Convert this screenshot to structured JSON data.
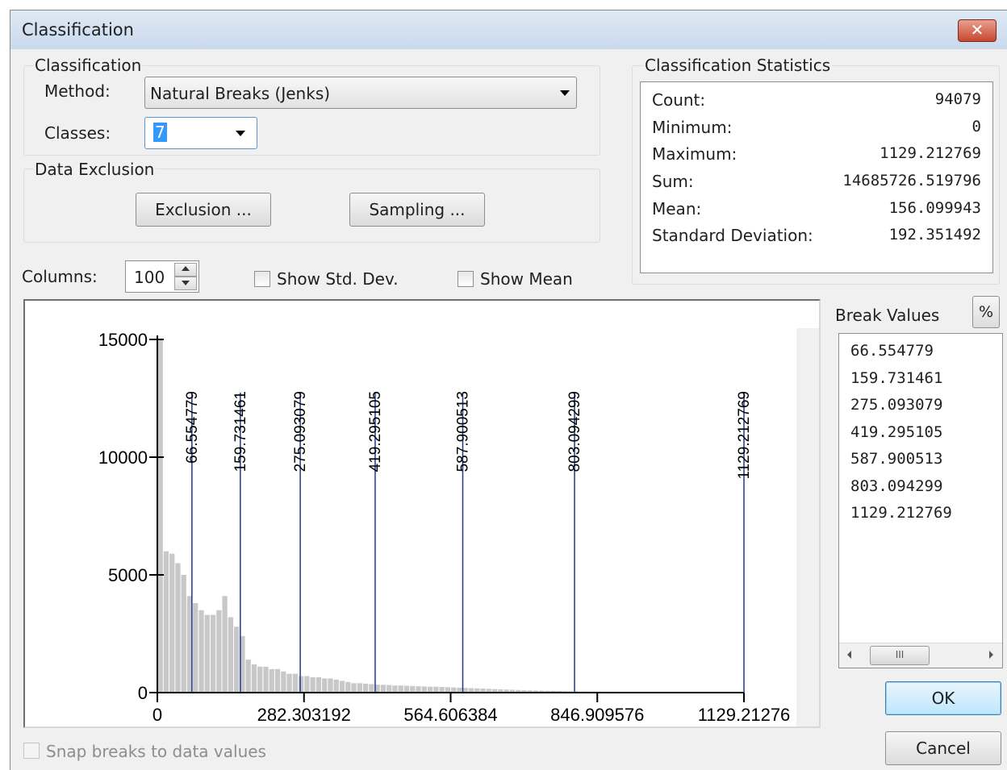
{
  "window": {
    "title": "Classification",
    "close_glyph": "✕"
  },
  "classification": {
    "group_label": "Classification",
    "method_label": "Method:",
    "method_value": "Natural Breaks (Jenks)",
    "classes_label": "Classes:",
    "classes_value": "7"
  },
  "data_exclusion": {
    "group_label": "Data Exclusion",
    "exclusion_button": "Exclusion ...",
    "sampling_button": "Sampling ..."
  },
  "statistics": {
    "group_label": "Classification Statistics",
    "rows": [
      {
        "label": "Count:",
        "value": "94079"
      },
      {
        "label": "Minimum:",
        "value": "0"
      },
      {
        "label": "Maximum:",
        "value": "1129.212769"
      },
      {
        "label": "Sum:",
        "value": "14685726.519796"
      },
      {
        "label": "Mean:",
        "value": "156.099943"
      },
      {
        "label": "Standard Deviation:",
        "value": "192.351492"
      }
    ]
  },
  "columns": {
    "label": "Columns:",
    "value": "100"
  },
  "show_std_dev": {
    "label": "Show Std. Dev.",
    "checked": false
  },
  "show_mean": {
    "label": "Show Mean",
    "checked": false
  },
  "break_values": {
    "label": "Break Values",
    "percent_button": "%",
    "values": [
      "66.554779",
      "159.731461",
      "275.093079",
      "419.295105",
      "587.900513",
      "803.094299",
      "1129.212769"
    ],
    "scroll_thumb": "III"
  },
  "snap_breaks": {
    "label": "Snap breaks to data values",
    "enabled": false
  },
  "buttons": {
    "ok": "OK",
    "cancel": "Cancel"
  },
  "colors": {
    "bar": "#c8c8c8",
    "break_line": "#1f3a8a",
    "title_bar": "#d2e0f0",
    "close_button": "#c8472e"
  },
  "chart_data": {
    "type": "bar",
    "title": "",
    "xlabel": "",
    "ylabel": "",
    "xlim": [
      0,
      1129.212769
    ],
    "ylim": [
      0,
      15000
    ],
    "y_ticks": [
      "0",
      "5000",
      "10000",
      "15000"
    ],
    "x_ticks": [
      "0",
      "282.303192",
      "564.606384",
      "846.909576",
      "1129.21276"
    ],
    "bin_width": 11.29212769,
    "counts": [
      15000,
      6000,
      5900,
      5500,
      5000,
      4100,
      3800,
      3500,
      3300,
      3300,
      3500,
      4100,
      3200,
      2800,
      2400,
      1400,
      1200,
      1100,
      1100,
      1000,
      1000,
      900,
      800,
      800,
      700,
      700,
      650,
      650,
      600,
      600,
      550,
      500,
      450,
      400,
      400,
      380,
      360,
      340,
      330,
      320,
      300,
      300,
      290,
      280,
      270,
      260,
      250,
      250,
      240,
      230,
      220,
      210,
      200,
      190,
      180,
      170,
      160,
      150,
      140,
      130,
      120,
      110,
      100,
      95,
      90,
      85,
      80,
      75,
      70,
      60,
      50,
      48,
      46,
      44,
      42,
      40,
      38,
      36,
      34,
      32,
      30,
      28,
      26,
      24,
      22,
      20,
      18,
      16,
      14,
      12,
      10,
      9,
      8,
      7,
      6,
      5,
      4,
      3,
      2,
      1
    ],
    "break_values": [
      66.554779,
      159.731461,
      275.093079,
      419.295105,
      587.900513,
      803.094299,
      1129.212769
    ],
    "break_labels": [
      "66.554779",
      "159.731461",
      "275.093079",
      "419.295105",
      "587.900513",
      "803.094299",
      "1129.212769"
    ]
  }
}
